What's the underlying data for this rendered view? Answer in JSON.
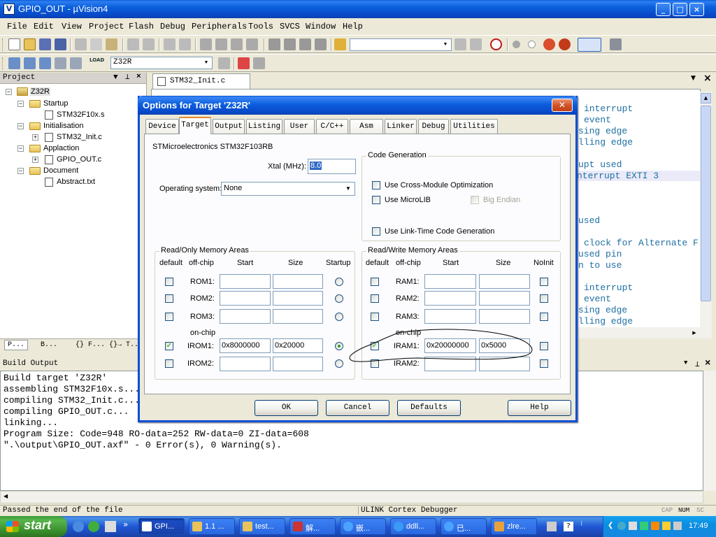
{
  "window": {
    "title": "GPIO_OUT  - µVision4",
    "controls": [
      "_",
      "□",
      "×"
    ]
  },
  "menubar": [
    "File",
    "Edit",
    "View",
    "Project",
    "Flash",
    "Debug",
    "Peripherals",
    "Tools",
    "SVCS",
    "Window",
    "Help"
  ],
  "toolbar2": {
    "target_combo": "Z32R",
    "load_label": "LOAD"
  },
  "project_panel": {
    "title": "Project",
    "tree": [
      {
        "label": "Z32R",
        "level": 0,
        "kind": "target"
      },
      {
        "label": "Startup",
        "level": 1,
        "kind": "folder"
      },
      {
        "label": "STM32F10x.s",
        "level": 2,
        "kind": "file"
      },
      {
        "label": "Initialisation",
        "level": 1,
        "kind": "folder"
      },
      {
        "label": "STM32_Init.c",
        "level": 2,
        "kind": "file"
      },
      {
        "label": "Applaction",
        "level": 1,
        "kind": "folder"
      },
      {
        "label": "GPIO_OUT.c",
        "level": 2,
        "kind": "file"
      },
      {
        "label": "Document",
        "level": 1,
        "kind": "folder"
      },
      {
        "label": "Abstract.txt",
        "level": 2,
        "kind": "file"
      }
    ],
    "tabs": [
      "P...",
      "B...",
      "{} F...",
      "{}→ T..."
    ]
  },
  "editor": {
    "tab_label": "STM32_Init.c",
    "lines": [
      "interrupt",
      "event",
      "sing edge",
      "lling edge",
      "",
      "upt used",
      "nterrupt EXTI 3",
      "",
      "",
      "",
      "used",
      "",
      "clock for Alternate F",
      "used pin",
      "n to use",
      "",
      "interrupt",
      "event",
      "sing edge",
      "lling edge"
    ]
  },
  "build_output": {
    "title": "Build Output",
    "lines": [
      "Build target 'Z32R'",
      "assembling STM32F10x.s...",
      "compiling STM32_Init.c...",
      "compiling GPIO_OUT.c...",
      "linking...",
      "Program Size: Code=948 RO-data=252 RW-data=0 ZI-data=608",
      "\".\\output\\GPIO_OUT.axf\" - 0 Error(s), 0 Warning(s)."
    ]
  },
  "status_bar": {
    "left": "Passed the end of the file",
    "debugger": "ULINK Cortex Debugger",
    "caps": "CAP",
    "num": "NUM",
    "scrl": "SC"
  },
  "taskbar": {
    "start": "start",
    "tasks": [
      "GPI...",
      "1.1 ...",
      "test...",
      "解...",
      "嵌...",
      "ddll...",
      "已...",
      "zlre..."
    ],
    "clock": "17:49"
  },
  "dialog": {
    "title": "Options for Target 'Z32R'",
    "tabs": [
      "Device",
      "Target",
      "Output",
      "Listing",
      "User",
      "C/C++",
      "Asm",
      "Linker",
      "Debug",
      "Utilities"
    ],
    "selected_tab": "Target",
    "device_name": "STMicroelectronics STM32F103RB",
    "xtal_label": "Xtal (MHz):",
    "xtal_value": "8.0",
    "os_label": "Operating system:",
    "os_value": "None",
    "code_generation": {
      "title": "Code Generation",
      "cross_module": "Use Cross-Module Optimization",
      "microlib": "Use MicroLIB",
      "big_endian": "Big Endian",
      "link_time": "Use Link-Time Code Generation"
    },
    "rom": {
      "title": "Read/Only Memory Areas",
      "headers": {
        "default": "default",
        "offchip": "off-chip",
        "start": "Start",
        "size": "Size",
        "startup": "Startup"
      },
      "onchip_label": "on-chip",
      "rows": [
        {
          "name": "ROM1:",
          "start": "",
          "size": "",
          "default": false,
          "startup": false
        },
        {
          "name": "ROM2:",
          "start": "",
          "size": "",
          "default": false,
          "startup": false
        },
        {
          "name": "ROM3:",
          "start": "",
          "size": "",
          "default": false,
          "startup": false
        },
        {
          "name": "IROM1:",
          "start": "0x8000000",
          "size": "0x20000",
          "default": true,
          "startup": true
        },
        {
          "name": "IROM2:",
          "start": "",
          "size": "",
          "default": false,
          "startup": false
        }
      ]
    },
    "ram": {
      "title": "Read/Write Memory Areas",
      "headers": {
        "default": "default",
        "offchip": "off-chip",
        "start": "Start",
        "size": "Size",
        "noinit": "NoInit"
      },
      "onchip_label": "on-chip",
      "rows": [
        {
          "name": "RAM1:",
          "start": "",
          "size": "",
          "default": false,
          "noinit": false
        },
        {
          "name": "RAM2:",
          "start": "",
          "size": "",
          "default": false,
          "noinit": false
        },
        {
          "name": "RAM3:",
          "start": "",
          "size": "",
          "default": false,
          "noinit": false
        },
        {
          "name": "IRAM1:",
          "start": "0x20000000",
          "size": "0x5000",
          "default": true,
          "noinit": false
        },
        {
          "name": "IRAM2:",
          "start": "",
          "size": "",
          "default": false,
          "noinit": false
        }
      ]
    },
    "buttons": {
      "ok": "OK",
      "cancel": "Cancel",
      "defaults": "Defaults",
      "help": "Help"
    }
  }
}
